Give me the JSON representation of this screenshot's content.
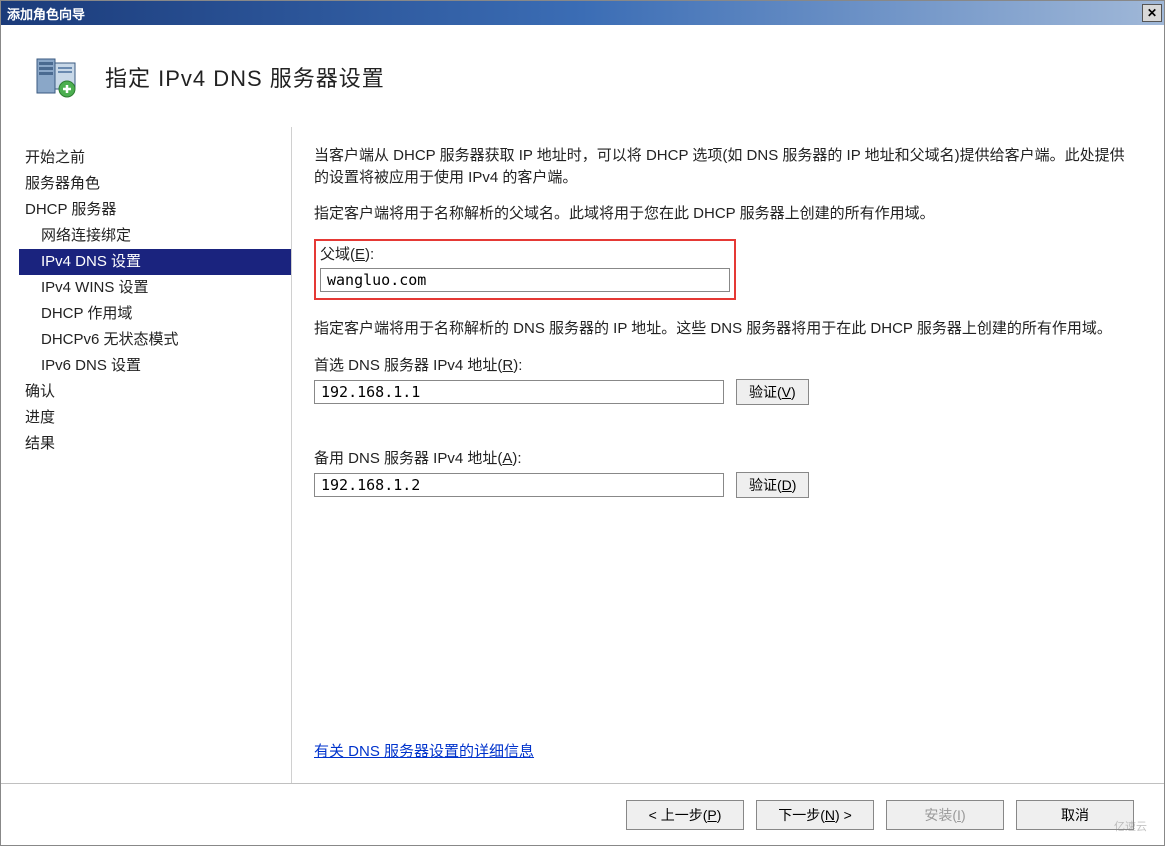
{
  "window": {
    "title": "添加角色向导"
  },
  "header": {
    "title": "指定 IPv4 DNS 服务器设置"
  },
  "sidebar": {
    "items": [
      {
        "label": "开始之前",
        "indent": false,
        "selected": false
      },
      {
        "label": "服务器角色",
        "indent": false,
        "selected": false
      },
      {
        "label": "DHCP 服务器",
        "indent": false,
        "selected": false
      },
      {
        "label": "网络连接绑定",
        "indent": true,
        "selected": false
      },
      {
        "label": "IPv4 DNS 设置",
        "indent": true,
        "selected": true
      },
      {
        "label": "IPv4 WINS 设置",
        "indent": true,
        "selected": false
      },
      {
        "label": "DHCP 作用域",
        "indent": true,
        "selected": false
      },
      {
        "label": "DHCPv6 无状态模式",
        "indent": true,
        "selected": false
      },
      {
        "label": "IPv6 DNS 设置",
        "indent": true,
        "selected": false
      },
      {
        "label": "确认",
        "indent": false,
        "selected": false
      },
      {
        "label": "进度",
        "indent": false,
        "selected": false
      },
      {
        "label": "结果",
        "indent": false,
        "selected": false
      }
    ]
  },
  "content": {
    "intro1": "当客户端从 DHCP 服务器获取 IP 地址时，可以将 DHCP 选项(如 DNS 服务器的 IP 地址和父域名)提供给客户端。此处提供的设置将被应用于使用 IPv4 的客户端。",
    "intro2": "指定客户端将用于名称解析的父域名。此域将用于您在此 DHCP 服务器上创建的所有作用域。",
    "parent_domain_label": "父域(E):",
    "parent_domain_value": "wangluo.com",
    "dns_intro": "指定客户端将用于名称解析的 DNS 服务器的 IP 地址。这些 DNS 服务器将用于在此 DHCP 服务器上创建的所有作用域。",
    "preferred_label": "首选 DNS 服务器 IPv4 地址(R):",
    "preferred_value": "192.168.1.1",
    "alternate_label": "备用 DNS 服务器 IPv4 地址(A):",
    "alternate_value": "192.168.1.2",
    "verify1": "验证(V)",
    "verify2": "验证(D)",
    "link": "有关 DNS 服务器设置的详细信息"
  },
  "footer": {
    "prev": "< 上一步(P)",
    "next": "下一步(N) >",
    "install": "安装(I)",
    "cancel": "取消"
  },
  "watermark": "亿速云"
}
